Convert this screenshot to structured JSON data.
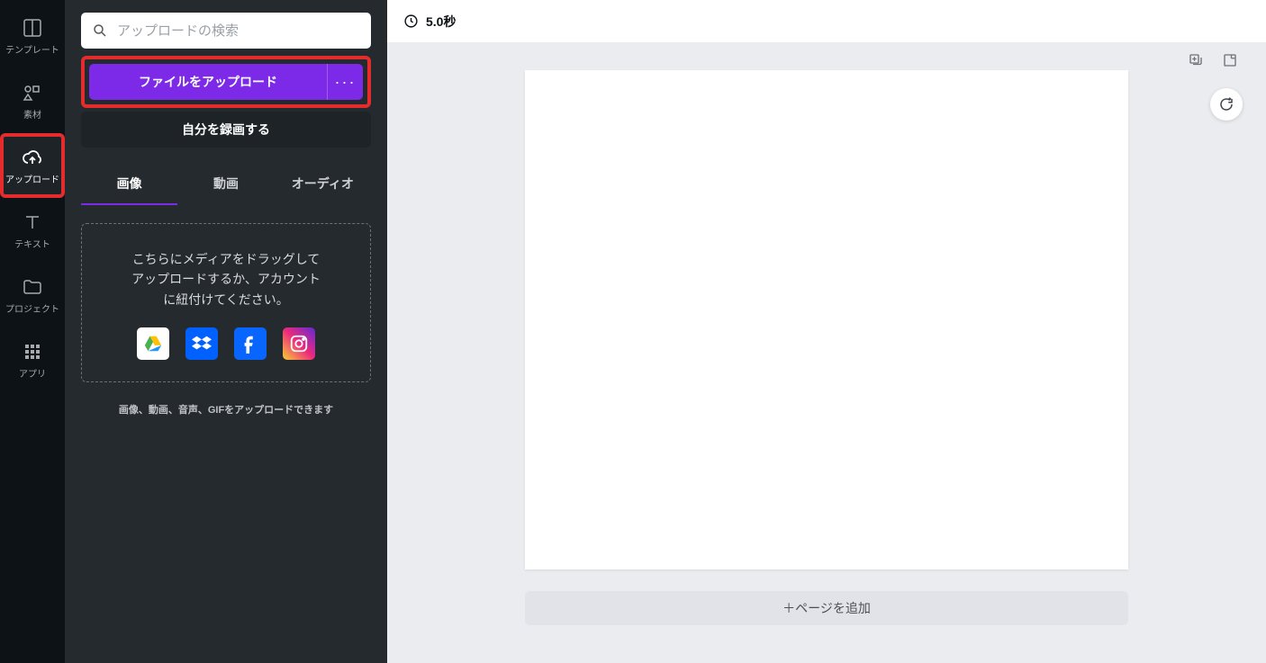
{
  "nav": {
    "items": [
      {
        "label": "テンプレート",
        "name": "template"
      },
      {
        "label": "素材",
        "name": "elements"
      },
      {
        "label": "アップロード",
        "name": "upload"
      },
      {
        "label": "テキスト",
        "name": "text"
      },
      {
        "label": "プロジェクト",
        "name": "projects"
      },
      {
        "label": "アプリ",
        "name": "apps"
      }
    ]
  },
  "panel": {
    "search_placeholder": "アップロードの検索",
    "upload_button": "ファイルをアップロード",
    "more_button": "···",
    "record_button": "自分を録画する",
    "tabs": [
      {
        "label": "画像"
      },
      {
        "label": "動画"
      },
      {
        "label": "オーディオ"
      }
    ],
    "drop_text_line1": "こちらにメディアをドラッグして",
    "drop_text_line2": "アップロードするか、アカウント",
    "drop_text_line3": "に紐付けてください。",
    "hint": "画像、動画、音声、GIFをアップロードできます"
  },
  "canvas": {
    "duration": "5.0秒",
    "add_page": "＋ページを追加"
  }
}
